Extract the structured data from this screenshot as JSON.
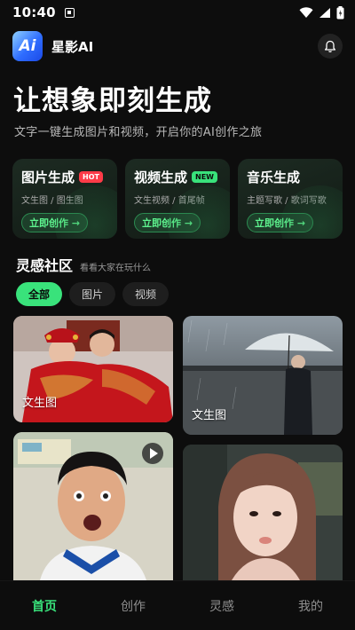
{
  "status_bar": {
    "time": "10:40",
    "icons": [
      "notification-icon",
      "wifi-icon",
      "signal-icon",
      "battery-icon"
    ]
  },
  "app": {
    "logo_text": "Ai",
    "name": "星影AI",
    "bell_icon": "bell-icon"
  },
  "hero": {
    "title": "让想象即刻生成",
    "subtitle": "文字一键生成图片和视频，开启你的AI创作之旅"
  },
  "features": [
    {
      "title": "图片生成",
      "badge": "HOT",
      "desc": "文生图 / 图生图",
      "button": "立即创作 →"
    },
    {
      "title": "视频生成",
      "badge": "NEW",
      "desc": "文生视频 / 首尾帧",
      "button": "立即创作 →"
    },
    {
      "title": "音乐生成",
      "badge": "",
      "desc": "主题写歌 / 歌词写歌",
      "button": "立即创作 →"
    }
  ],
  "community": {
    "title": "灵感社区",
    "subtitle": "看看大家在玩什么",
    "filters": [
      "全部",
      "图片",
      "视频"
    ],
    "active_filter": "全部",
    "items": [
      {
        "label": "文生图"
      },
      {
        "label": "文生图"
      },
      {
        "label": ""
      },
      {
        "label": ""
      }
    ]
  },
  "nav": {
    "items": [
      "首页",
      "创作",
      "灵感",
      "我的"
    ],
    "active": "首页"
  },
  "colors": {
    "accent": "#39e27b",
    "hot": "#ff3b48",
    "background": "#0d0d0d"
  }
}
